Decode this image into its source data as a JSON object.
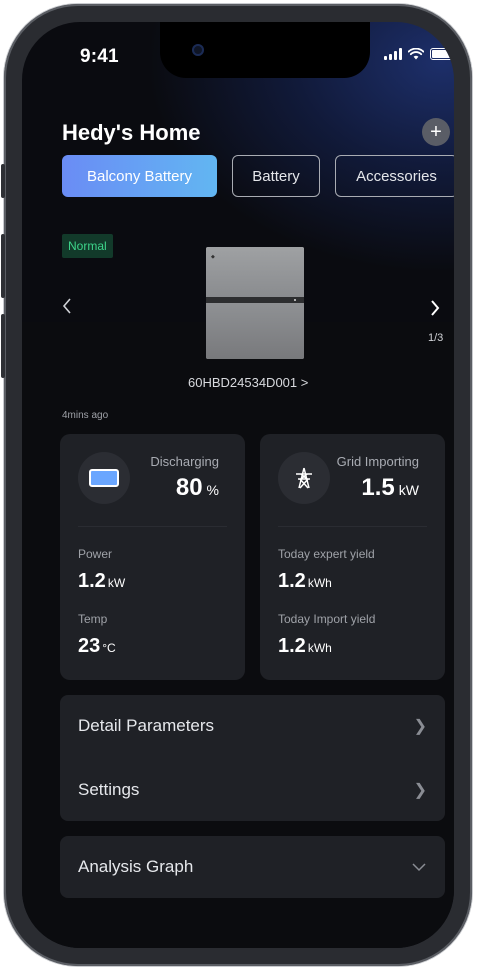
{
  "status_bar": {
    "time": "9:41"
  },
  "header": {
    "title": "Hedy's Home",
    "add_label": "+"
  },
  "tabs": [
    {
      "label": "Balcony Battery",
      "active": true
    },
    {
      "label": "Battery",
      "active": false
    },
    {
      "label": "Accessories",
      "active": false
    }
  ],
  "device": {
    "status": "Normal",
    "status_color": "#3dd58a",
    "pager": "1/3",
    "serial": "60HBD24534D001 >",
    "updated": "4mins ago"
  },
  "cards": {
    "battery": {
      "icon": "battery-icon",
      "state": "Discharging",
      "percent": "80",
      "percent_unit": "%",
      "power_label": "Power",
      "power_value": "1.2",
      "power_unit": "kW",
      "temp_label": "Temp",
      "temp_value": "23",
      "temp_unit": "°C"
    },
    "grid": {
      "icon": "power-tower-icon",
      "state": "Grid Importing",
      "power_value": "1.5",
      "power_unit": "kW",
      "export_label": "Today expert yield",
      "export_value": "1.2",
      "export_unit": "kWh",
      "import_label": "Today Import yield",
      "import_value": "1.2",
      "import_unit": "kWh"
    }
  },
  "menu": {
    "detail_label": "Detail Parameters",
    "settings_label": "Settings",
    "analysis_label": "Analysis Graph"
  },
  "colors": {
    "accent_start": "#6a8cf5",
    "accent_end": "#62b6f2",
    "background": "#0b0c0f",
    "card": "#1f2126"
  }
}
